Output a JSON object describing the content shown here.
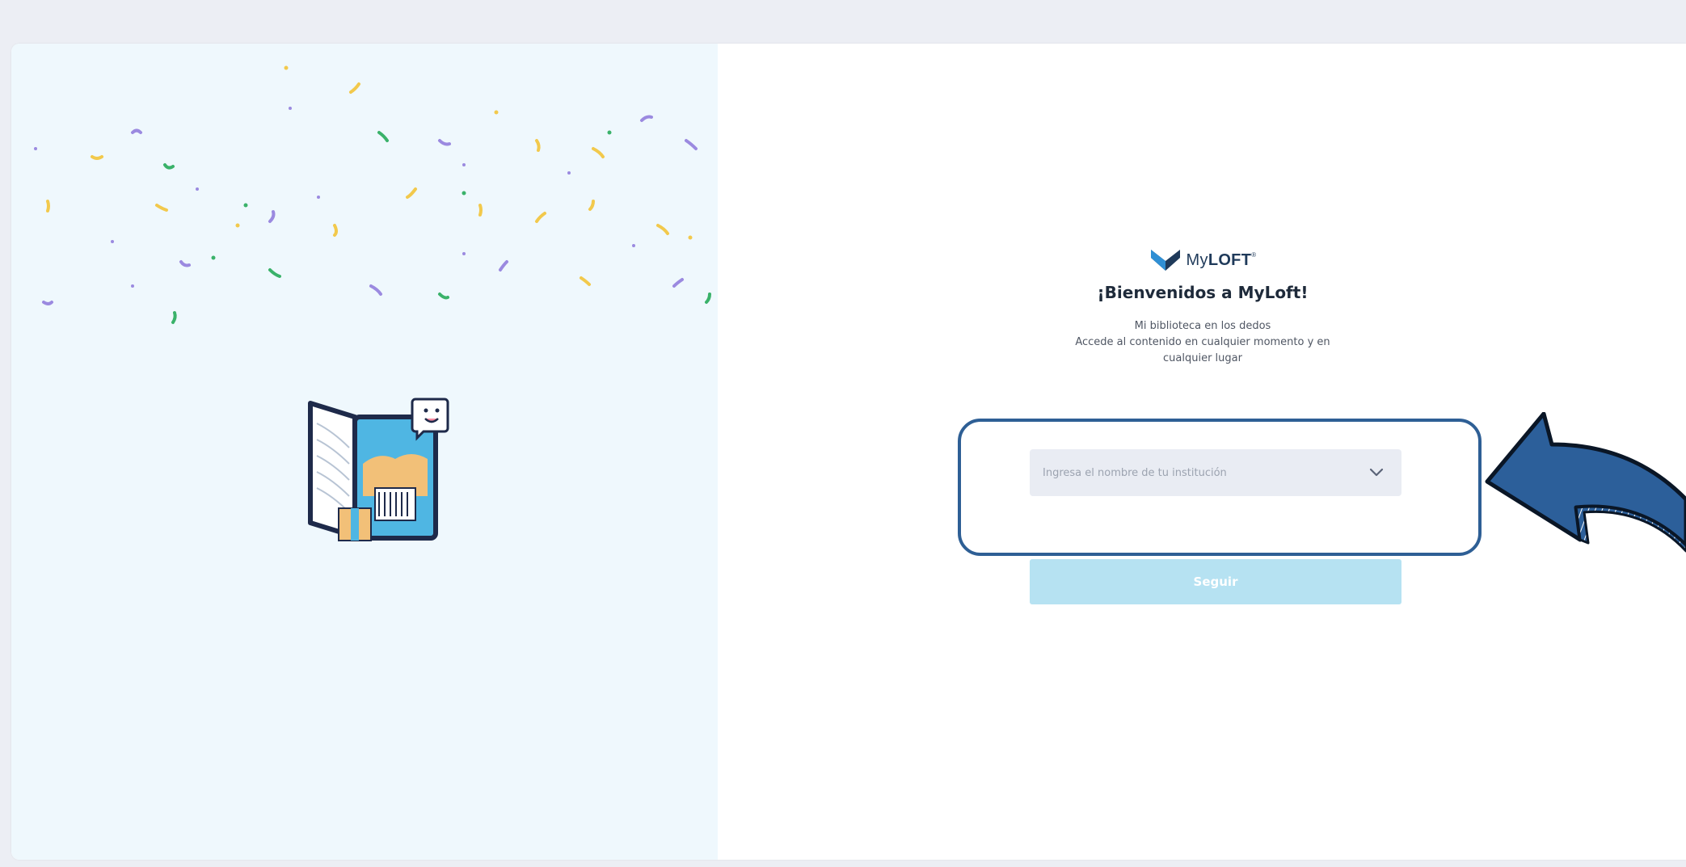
{
  "brand": {
    "name_prefix": "My",
    "name_bold": "LOFT",
    "trademark": "®"
  },
  "welcome": {
    "title": "¡Bienvenidos a MyLoft!",
    "line1": "Mi biblioteca en los dedos",
    "line2": "Accede al contenido en cualquier momento y en",
    "line3": "cualquier lugar"
  },
  "institution_select": {
    "placeholder": "Ingresa el nombre de tu institución",
    "icon": "chevron-down-icon"
  },
  "continue_button": {
    "label": "Seguir"
  },
  "colors": {
    "left_panel_bg": "#eff8fd",
    "brand_dark": "#1f3a5a",
    "brand_blue": "#2f8fd4",
    "button_bg": "#b6e2f2",
    "annotation_blue": "#2e5f95"
  }
}
